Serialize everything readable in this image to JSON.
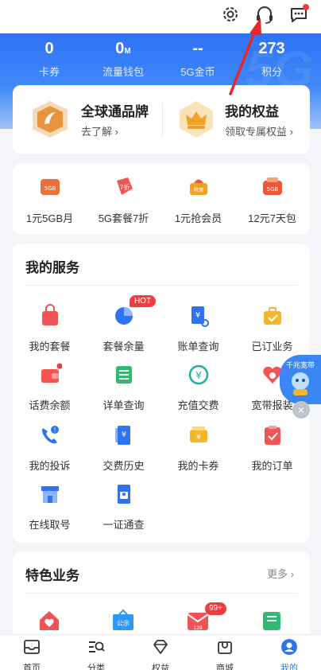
{
  "header": {
    "icons": [
      "gear-icon",
      "headset-icon",
      "chat-icon"
    ]
  },
  "stats": [
    {
      "value": "0",
      "unit": "",
      "label": "卡券"
    },
    {
      "value": "0",
      "unit": "M",
      "label": "流量钱包"
    },
    {
      "value": "--",
      "unit": "",
      "label": "5G金币"
    },
    {
      "value": "273",
      "unit": "",
      "label": "积分"
    }
  ],
  "brand": {
    "left": {
      "title": "全球通品牌",
      "sub": "去了解"
    },
    "right": {
      "title": "我的权益",
      "sub": "领取专属权益"
    }
  },
  "promos": [
    {
      "label": "1元5GB月",
      "pic_text": "5GB"
    },
    {
      "label": "5G套餐7折",
      "pic_text": "7折"
    },
    {
      "label": "1元抢会员",
      "pic_text": "特惠"
    },
    {
      "label": "12元7天包",
      "pic_text": "5GB"
    }
  ],
  "services": {
    "title": "我的服务",
    "hot_badge": "HOT",
    "items": [
      {
        "label": "我的套餐",
        "icon": "bag-icon"
      },
      {
        "label": "套餐余量",
        "icon": "pie-chart-icon"
      },
      {
        "label": "账单查询",
        "icon": "bill-icon"
      },
      {
        "label": "已订业务",
        "icon": "briefcase-icon"
      },
      {
        "label": "话费余额",
        "icon": "wallet-icon"
      },
      {
        "label": "详单查询",
        "icon": "list-icon"
      },
      {
        "label": "充值交费",
        "icon": "recharge-icon"
      },
      {
        "label": "宽带报装",
        "icon": "broadband-icon"
      },
      {
        "label": "我的投诉",
        "icon": "complaint-phone-icon"
      },
      {
        "label": "交费历史",
        "icon": "payment-history-icon"
      },
      {
        "label": "我的卡券",
        "icon": "coupon-icon"
      },
      {
        "label": "我的订单",
        "icon": "order-icon"
      },
      {
        "label": "在线取号",
        "icon": "store-icon"
      },
      {
        "label": "一证通查",
        "icon": "id-check-icon"
      }
    ]
  },
  "featured": {
    "title": "特色业务",
    "more_label": "更多",
    "badge": "99+",
    "items": [
      {
        "icon": "home-heart-icon",
        "pic_text": ""
      },
      {
        "icon": "notice-icon",
        "pic_text": "公示"
      },
      {
        "icon": "mail-139-icon",
        "pic_text": "139"
      },
      {
        "icon": "document-icon",
        "pic_text": ""
      }
    ]
  },
  "floating_ad": {
    "text": "千兆宽带"
  },
  "tabs": [
    {
      "label": "首页",
      "icon": "inbox-icon"
    },
    {
      "label": "分类",
      "icon": "category-search-icon"
    },
    {
      "label": "权益",
      "icon": "diamond-icon"
    },
    {
      "label": "商城",
      "icon": "shop-icon"
    },
    {
      "label": "我的",
      "icon": "profile-icon"
    }
  ],
  "colors": {
    "brand_blue": "#2f73f5",
    "accent_red": "#f03b3b",
    "annotation_arrow": "#e8252b"
  }
}
